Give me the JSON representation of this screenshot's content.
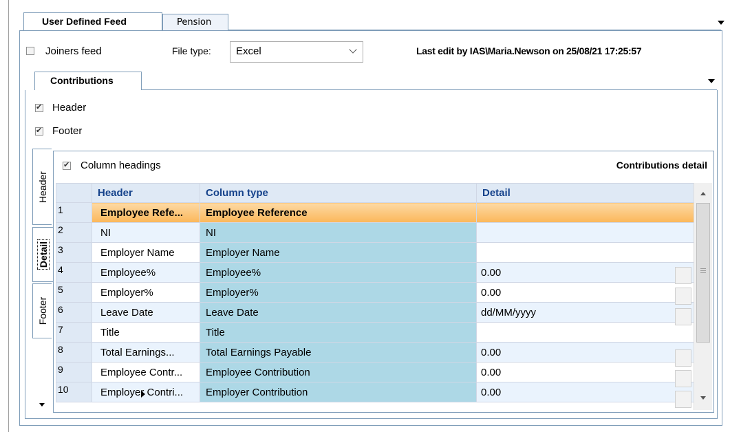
{
  "tabs": {
    "top": [
      {
        "label": "User Defined Feed",
        "active": true
      },
      {
        "label": "Pension",
        "active": false
      }
    ],
    "contributions": {
      "label": "Contributions"
    }
  },
  "feed": {
    "joiners_label": "Joiners feed",
    "joiners_checked": false,
    "file_type_label": "File type:",
    "file_type_value": "Excel",
    "last_edit": "Last edit by IAS\\Maria.Newson on 25/08/21 17:25:57"
  },
  "options": {
    "header_label": "Header",
    "header_checked": true,
    "footer_label": "Footer",
    "footer_checked": true
  },
  "side_tabs": [
    {
      "label": "Header",
      "active": false
    },
    {
      "label": "Detail",
      "active": true
    },
    {
      "label": "Footer",
      "active": false
    }
  ],
  "detail": {
    "column_headings_label": "Column headings",
    "column_headings_checked": true,
    "title": "Contributions detail",
    "columns": [
      "Header",
      "Column type",
      "Detail"
    ],
    "rows": [
      {
        "n": "1",
        "header": "Employee Refe...",
        "type": "Employee Reference",
        "detail": "",
        "selected": true,
        "button": false
      },
      {
        "n": "2",
        "header": "NI",
        "type": "NI",
        "detail": "",
        "selected": false,
        "button": false
      },
      {
        "n": "3",
        "header": "Employer Name",
        "type": "Employer Name",
        "detail": "",
        "selected": false,
        "button": false
      },
      {
        "n": "4",
        "header": "Employee%",
        "type": "Employee%",
        "detail": "0.00",
        "selected": false,
        "button": true
      },
      {
        "n": "5",
        "header": "Employer%",
        "type": "Employer%",
        "detail": "0.00",
        "selected": false,
        "button": true
      },
      {
        "n": "6",
        "header": "Leave Date",
        "type": "Leave Date",
        "detail": "dd/MM/yyyy",
        "selected": false,
        "button": true
      },
      {
        "n": "7",
        "header": "Title",
        "type": "Title",
        "detail": "",
        "selected": false,
        "button": false
      },
      {
        "n": "8",
        "header": "Total Earnings...",
        "type": "Total Earnings Payable",
        "detail": "0.00",
        "selected": false,
        "button": true
      },
      {
        "n": "9",
        "header": "Employee Contr...",
        "type": "Employee Contribution",
        "detail": "0.00",
        "selected": false,
        "button": true
      },
      {
        "n": "10",
        "header": "Employer Contri...",
        "type": "Employer Contribution",
        "detail": "0.00",
        "selected": false,
        "button": true
      }
    ]
  }
}
